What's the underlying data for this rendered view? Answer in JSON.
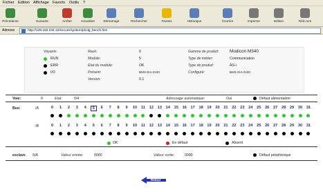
{
  "menu": [
    "Fichier",
    "Edition",
    "Affichage",
    "Favoris",
    "Outils",
    "?"
  ],
  "toolbar": [
    {
      "label": "Précédente",
      "icon": "back-arrow-icon",
      "color": "#3d8b3d"
    },
    {
      "label": "Suivante",
      "icon": "forward-arrow-icon",
      "color": "#3d8b3d"
    },
    {
      "label": "Arrêter",
      "icon": "stop-icon",
      "color": "#c0392b"
    },
    {
      "label": "Actualiser",
      "icon": "refresh-icon",
      "color": "#3d8b3d"
    },
    {
      "label": "Démarrage",
      "icon": "home-icon",
      "color": "#5a7fb8"
    },
    {
      "label": "Rechercher",
      "icon": "search-icon",
      "color": "#5a7fb8"
    },
    {
      "label": "Favoris",
      "icon": "favorites-icon",
      "color": "#e6b800"
    },
    {
      "label": "Historique",
      "icon": "history-icon",
      "color": "#5a7fb8"
    },
    {
      "label": "Courrier",
      "icon": "mail-icon",
      "color": "#5a7fb8"
    },
    {
      "label": "Imprimer",
      "icon": "print-icon",
      "color": "#777777"
    },
    {
      "label": "Edition",
      "icon": "edit-icon",
      "color": "#777777"
    },
    {
      "label": "Réd.com",
      "icon": "discuss-icon",
      "color": "#777777"
    }
  ],
  "address": {
    "label": "Adresse",
    "url": "http://139.160.234.12/secure/system/plcdg_bench.htm"
  },
  "module_info": {
    "voyants_label": "Voyants",
    "leds": [
      {
        "name": "RUN",
        "color": "#22cc22"
      },
      {
        "name": "ERR",
        "color": "#000000"
      },
      {
        "name": "I/O",
        "color": "#000000"
      }
    ],
    "rack": {
      "label": "Rack:",
      "value": "0"
    },
    "module": {
      "label": "Module:",
      "value": "5"
    },
    "etat": {
      "label": "Etat du module:",
      "value": "OK"
    },
    "présent": {
      "label": "Présent:",
      "value": "BMX EIA 0100"
    },
    "version": {
      "label": "Version:",
      "value": "0.1"
    },
    "gamme": {
      "label": "Gamme de produit:",
      "value": "Modicon M340"
    },
    "metier": {
      "label": "Type de métier:",
      "value": "Communication"
    },
    "produit": {
      "label": "Type de produit:",
      "value": "AS-i"
    },
    "configure": {
      "label": "Configuré:",
      "value": "BMX EIA 0100"
    }
  },
  "voie": {
    "label": "Voie:",
    "value": "0",
    "etat_label": "Etat:",
    "etat_value": "0/4",
    "adr_label": "Adressage automatique:",
    "adr_value": "Oui",
    "defaut_alim": "Défaut alimentation"
  },
  "bus": {
    "label": "Bus:",
    "rowA_label": "/A",
    "rowB_label": "/B",
    "numbers": [
      "0",
      "1",
      "2",
      "3",
      "4",
      "5",
      "6",
      "7",
      "8",
      "9",
      "10",
      "11",
      "12",
      "13",
      "14",
      "15",
      "16",
      "17",
      "18",
      "19",
      "20",
      "21",
      "22",
      "23",
      "24",
      "25",
      "26",
      "27",
      "28",
      "29",
      "30",
      "31"
    ],
    "selected_index": 5,
    "rowA_states": [
      "black",
      "black",
      "green",
      "green",
      "green",
      "green",
      "green",
      "green",
      "green",
      "green",
      "green",
      "green",
      "black",
      "black",
      "green",
      "green",
      "green",
      "green",
      "green",
      "green",
      "green",
      "green",
      "green",
      "green",
      "green",
      "green",
      "green",
      "green",
      "green",
      "green",
      "green",
      "green"
    ],
    "rowB_states": [
      "black",
      "black",
      "black",
      "black",
      "black",
      "black",
      "black",
      "black",
      "black",
      "black",
      "black",
      "black",
      "black",
      "black",
      "black",
      "black",
      "black",
      "black",
      "black",
      "black",
      "black",
      "black",
      "black",
      "black",
      "black",
      "black",
      "black",
      "black",
      "black",
      "black",
      "black",
      "black"
    ],
    "legend": [
      {
        "label": "OK",
        "color": "#22cc22"
      },
      {
        "label": "En défaut",
        "color": "#e01b1b"
      },
      {
        "label": "Absent",
        "color": "#000000"
      }
    ]
  },
  "esclave": {
    "label": "esclave",
    "value": "5/A",
    "entree_label": "Valeur entrée:",
    "entree_value": "0000",
    "sortie_label": "Valeur sortie:",
    "sortie_value": "0000",
    "defaut_peripherique": "Défaut périphérique"
  },
  "back_button": {
    "label": "Retour",
    "color": "#2233cc"
  }
}
